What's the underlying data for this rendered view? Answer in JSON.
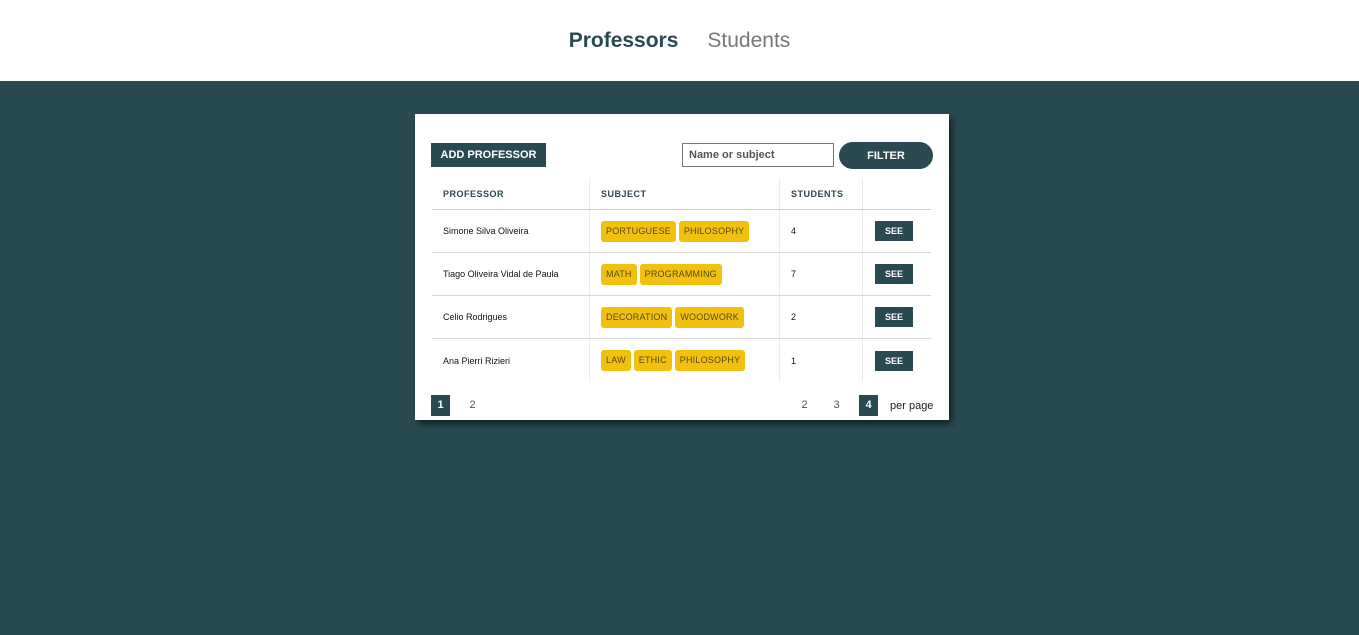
{
  "nav": {
    "tabs": [
      {
        "label": "Professors",
        "active": true
      },
      {
        "label": "Students",
        "active": false
      }
    ]
  },
  "toolbar": {
    "add_label": "ADD PROFESSOR",
    "search_placeholder": "Name or subject",
    "search_value": "",
    "filter_label": "FILTER"
  },
  "table": {
    "headers": [
      "PROFESSOR",
      "SUBJECT",
      "STUDENTS",
      ""
    ],
    "rows": [
      {
        "professor": "Simone Silva Oliveira",
        "subjects": [
          "PORTUGUESE",
          "PHILOSOPHY"
        ],
        "students": "4",
        "action": "SEE"
      },
      {
        "professor": "Tiago Oliveira Vidal de Paula",
        "subjects": [
          "MATH",
          "PROGRAMMING"
        ],
        "students": "7",
        "action": "SEE"
      },
      {
        "professor": "Celio Rodrigues",
        "subjects": [
          "DECORATION",
          "WOODWORK"
        ],
        "students": "2",
        "action": "SEE"
      },
      {
        "professor": "Ana Pierri Rizieri",
        "subjects": [
          "LAW",
          "ETHIC",
          "PHILOSOPHY"
        ],
        "students": "1",
        "action": "SEE"
      }
    ]
  },
  "pagination": {
    "pages": [
      "1",
      "2"
    ],
    "current_page": "1",
    "per_page_options": [
      "2",
      "3",
      "4"
    ],
    "current_per_page": "4",
    "per_page_label": "per page"
  },
  "colors": {
    "primary": "#294a51",
    "tag": "#f2c00e",
    "nav_inactive": "#777777"
  }
}
